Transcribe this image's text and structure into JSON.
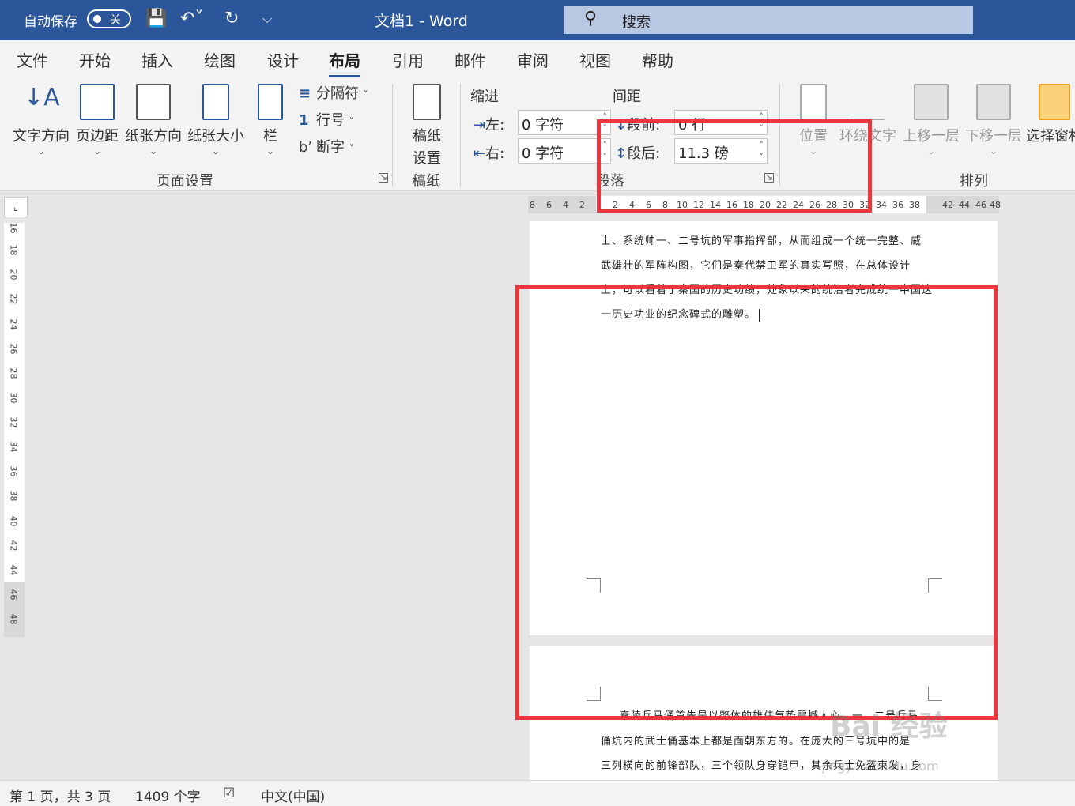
{
  "titlebar": {
    "autosave_label": "自动保存",
    "autosave_state": "关",
    "doc_title": "文档1  -  Word",
    "search_placeholder": "搜索",
    "icons": [
      "save-icon",
      "undo-icon",
      "redo-icon",
      "customize-icon"
    ]
  },
  "tabs": [
    "文件",
    "开始",
    "插入",
    "绘图",
    "设计",
    "布局",
    "引用",
    "邮件",
    "审阅",
    "视图",
    "帮助"
  ],
  "active_tab": "布局",
  "ribbon": {
    "page_setup": {
      "text_direction": "文字方向",
      "margins": "页边距",
      "orientation": "纸张方向",
      "size": "纸张大小",
      "columns": "栏",
      "breaks": "分隔符",
      "line_numbers": "行号",
      "hyphenation": "断字",
      "group_label": "页面设置"
    },
    "manuscript": {
      "label_line1": "稿纸",
      "label_line2": "设置",
      "group_label": "稿纸"
    },
    "paragraph": {
      "indent_header": "缩进",
      "spacing_header": "间距",
      "left_label": "左:",
      "left_value": "0 字符",
      "right_label": "右:",
      "right_value": "0 字符",
      "before_label": "段前:",
      "before_value": "0 行",
      "after_label": "段后:",
      "after_value": "11.3 磅",
      "group_label": "段落"
    },
    "arrange": {
      "position": "位置",
      "wrap_text": "环绕文字",
      "bring_forward": "上移一层",
      "send_backward": "下移一层",
      "selection_pane": "选择窗格",
      "group_label": "排列"
    }
  },
  "ruler": {
    "h_left_numbers": [
      "8",
      "6",
      "4",
      "2"
    ],
    "h_numbers": [
      "2",
      "4",
      "6",
      "8",
      "10",
      "12",
      "14",
      "16",
      "18",
      "20",
      "22",
      "24",
      "26",
      "28",
      "30",
      "32",
      "34",
      "36",
      "38"
    ],
    "h_right_numbers": [
      "42",
      "44",
      "46",
      "48"
    ],
    "v_numbers": [
      "16",
      "18",
      "20",
      "22",
      "24",
      "26",
      "28",
      "30",
      "32",
      "34",
      "36",
      "38",
      "40",
      "42",
      "44",
      "46",
      "48"
    ]
  },
  "document": {
    "page1_lines": [
      "士、系统帅一、二号坑的军事指挥部，从而组成一个统一完整、威",
      "武雄壮的军阵构图，它们是秦代禁卫军的真实写照，在总体设计",
      "上，可以看着了秦国的历史功绩，处象以来的统治者完成统一中国这",
      "一历史功业的纪念碑式的雕塑。"
    ],
    "page2_lines": [
      "秦陵兵马俑首先是以整体的雄伟气势震撼人心，一、二号兵马",
      "俑坑内的武士俑基本上都是面朝东方的。在庞大的三号坑中的是",
      "三列横向的前锋部队，三个领队身穿铠甲，其余兵士免盔束发，身"
    ]
  },
  "statusbar": {
    "page_info": "第 1 页，共 3 页",
    "word_count": "1409 个字",
    "language": "中文(中国)"
  },
  "watermark": {
    "text": "Bai 经验",
    "url": "jingyan.baidu.com"
  },
  "colors": {
    "title_bar": "#2b579a",
    "highlight": "#e8373d"
  }
}
